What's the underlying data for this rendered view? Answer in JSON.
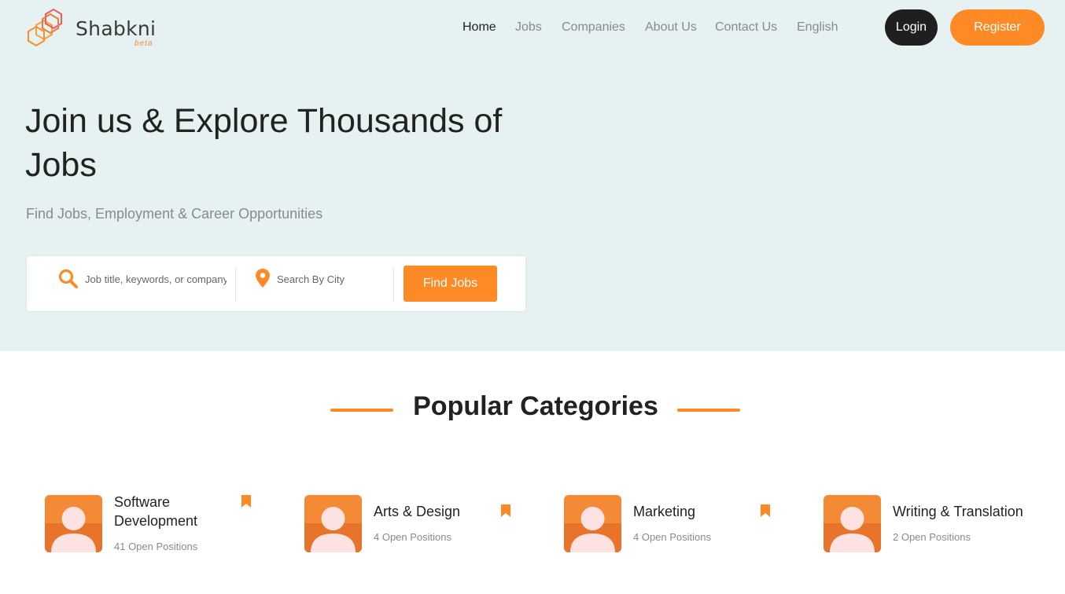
{
  "brand": {
    "name": "Shabkni",
    "tag": "beta"
  },
  "nav": {
    "items": [
      "Home",
      "Jobs",
      "Companies",
      "About Us",
      "Contact Us",
      "English"
    ],
    "active": "Home"
  },
  "auth": {
    "login": "Login",
    "register": "Register"
  },
  "hero": {
    "title": "Join us & Explore Thousands of Jobs",
    "subtitle": "Find Jobs, Employment & Career Opportunities"
  },
  "search": {
    "keyword_placeholder": "Job title, keywords, or company",
    "city_placeholder": "Search By City",
    "button": "Find Jobs"
  },
  "categories": {
    "title": "Popular Categories",
    "items": [
      {
        "name": "Software Development",
        "count": "41 Open Positions",
        "icon": "user-avatar-icon"
      },
      {
        "name": "Arts & Design",
        "count": "4 Open Positions",
        "icon": "user-avatar-icon"
      },
      {
        "name": "Marketing",
        "count": "4 Open Positions",
        "icon": "user-avatar-icon"
      },
      {
        "name": "Writing & Translation",
        "count": "2 Open Positions",
        "icon": "user-avatar-icon"
      }
    ]
  },
  "colors": {
    "accent": "#fd8a24",
    "hero_bg": "#e6f2f2",
    "dark": "#1f1f1f"
  }
}
